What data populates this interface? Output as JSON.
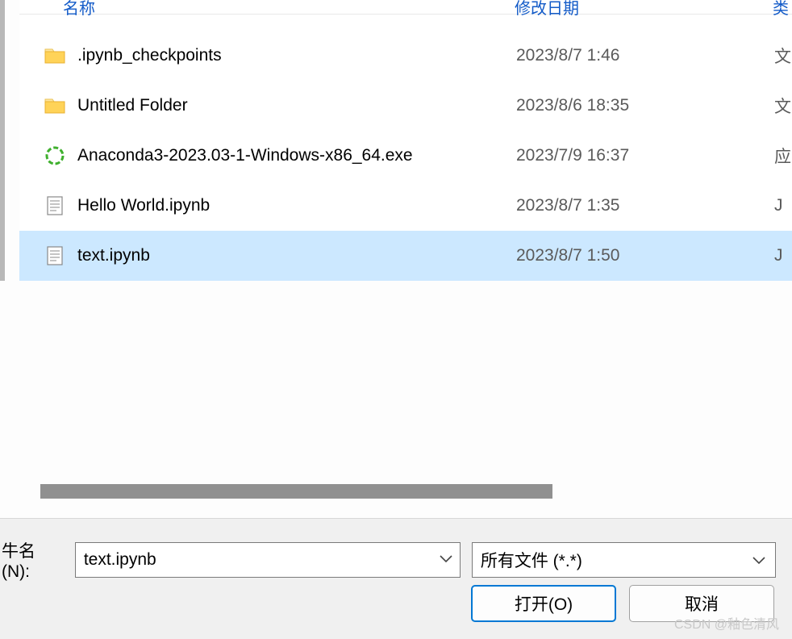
{
  "columns": {
    "name": "名称",
    "date": "修改日期",
    "type": "类"
  },
  "files": [
    {
      "icon": "folder",
      "name": ".ipynb_checkpoints",
      "date": "2023/8/7 1:46",
      "type": "文"
    },
    {
      "icon": "folder",
      "name": "Untitled Folder",
      "date": "2023/8/6 18:35",
      "type": "文"
    },
    {
      "icon": "anaconda",
      "name": "Anaconda3-2023.03-1-Windows-x86_64.exe",
      "date": "2023/7/9 16:37",
      "type": "应"
    },
    {
      "icon": "notebook",
      "name": "Hello World.ipynb",
      "date": "2023/8/7 1:35",
      "type": "J"
    },
    {
      "icon": "notebook",
      "name": "text.ipynb",
      "date": "2023/8/7 1:50",
      "type": "J"
    }
  ],
  "selectedIndex": 4,
  "footer": {
    "filenameLabel": "牛名(N):",
    "filenameValue": "text.ipynb",
    "filterValue": "所有文件 (*.*)",
    "openButton": "打开(O)",
    "cancelButton": "取消"
  },
  "watermark": "CSDN @釉色清风"
}
